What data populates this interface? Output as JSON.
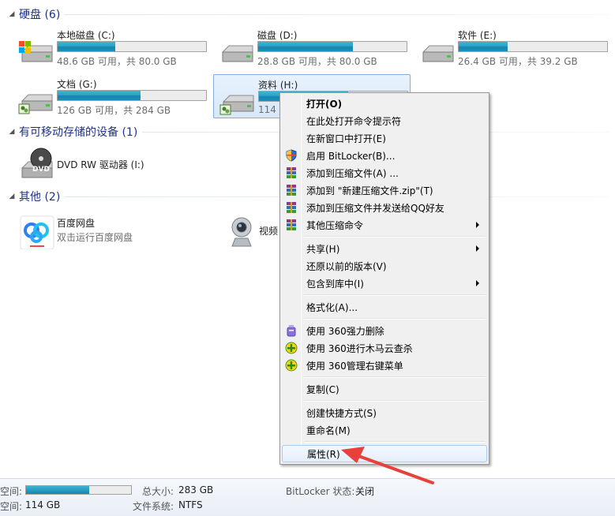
{
  "groups": {
    "hard_disks": {
      "title": "硬盘 (6)"
    },
    "removable": {
      "title": "有可移动存储的设备 (1)"
    },
    "other": {
      "title": "其他 (2)"
    }
  },
  "drives": [
    {
      "name": "本地磁盘 (C:)",
      "info": "48.6 GB 可用，共 80.0 GB",
      "used_fraction": 0.39,
      "icon": "windows-drive-icon"
    },
    {
      "name": "磁盘 (D:)",
      "info": "28.8 GB 可用，共 80.0 GB",
      "used_fraction": 0.64,
      "icon": "hard-drive-icon"
    },
    {
      "name": "软件 (E:)",
      "info": "26.4 GB 可用，共 39.2 GB",
      "used_fraction": 0.33,
      "icon": "hard-drive-icon"
    },
    {
      "name": "文档 (G:)",
      "info": "126 GB 可用，共 284 GB",
      "used_fraction": 0.56,
      "icon": "shared-drive-icon"
    },
    {
      "name": "资料 (H:)",
      "info": "114",
      "used_fraction": 0.6,
      "icon": "shared-drive-icon"
    }
  ],
  "removable": {
    "name": "DVD RW 驱动器 (I:)",
    "icon": "dvd-drive-icon",
    "badge": "DVD"
  },
  "other_items": [
    {
      "name": "百度网盘",
      "sub": "双击运行百度网盘",
      "icon": "baidu-netdisk-icon"
    },
    {
      "name": "视频",
      "icon": "webcam-icon"
    }
  ],
  "context_menu": {
    "items": [
      {
        "label": "打开(O)",
        "bold": true
      },
      {
        "label": "在此处打开命令提示符"
      },
      {
        "label": "在新窗口中打开(E)"
      },
      {
        "label": "启用 BitLocker(B)...",
        "icon": "shield-icon"
      },
      {
        "label": "添加到压缩文件(A) ...",
        "icon": "winrar-icon"
      },
      {
        "label": "添加到 \"新建压缩文件.zip\"(T)",
        "icon": "winrar-icon"
      },
      {
        "label": "添加到压缩文件并发送给QQ好友",
        "icon": "winrar-icon"
      },
      {
        "label": "其他压缩命令",
        "icon": "winrar-icon",
        "submenu": true
      },
      {
        "label": "共享(H)",
        "submenu": true
      },
      {
        "label": "还原以前的版本(V)"
      },
      {
        "label": "包含到库中(I)",
        "submenu": true
      },
      {
        "label": "格式化(A)..."
      },
      {
        "label": "使用 360强力删除",
        "icon": "360-delete-icon"
      },
      {
        "label": "使用 360进行木马云查杀",
        "icon": "360-scan-icon"
      },
      {
        "label": "使用 360管理右键菜单",
        "icon": "360-manage-icon"
      },
      {
        "label": "复制(C)"
      },
      {
        "label": "创建快捷方式(S)"
      },
      {
        "label": "重命名(M)"
      },
      {
        "label": "属性(R)",
        "highlighted": true
      }
    ]
  },
  "details_pane": {
    "space_used_label": "空间:",
    "used_fraction": 0.6,
    "total_size_label": "总大小:",
    "total_size": "283 GB",
    "bitlocker_label": "BitLocker 状态:",
    "bitlocker_value": "关闭",
    "space_free_label": "空间:",
    "space_free": "114 GB",
    "filesystem_label": "文件系统:",
    "filesystem": "NTFS"
  },
  "colors": {
    "group_title": "#1e3287",
    "bar_fill": "#2aa3c6",
    "annotation_arrow": "#e8403a",
    "selection": "#d6e8fa"
  }
}
